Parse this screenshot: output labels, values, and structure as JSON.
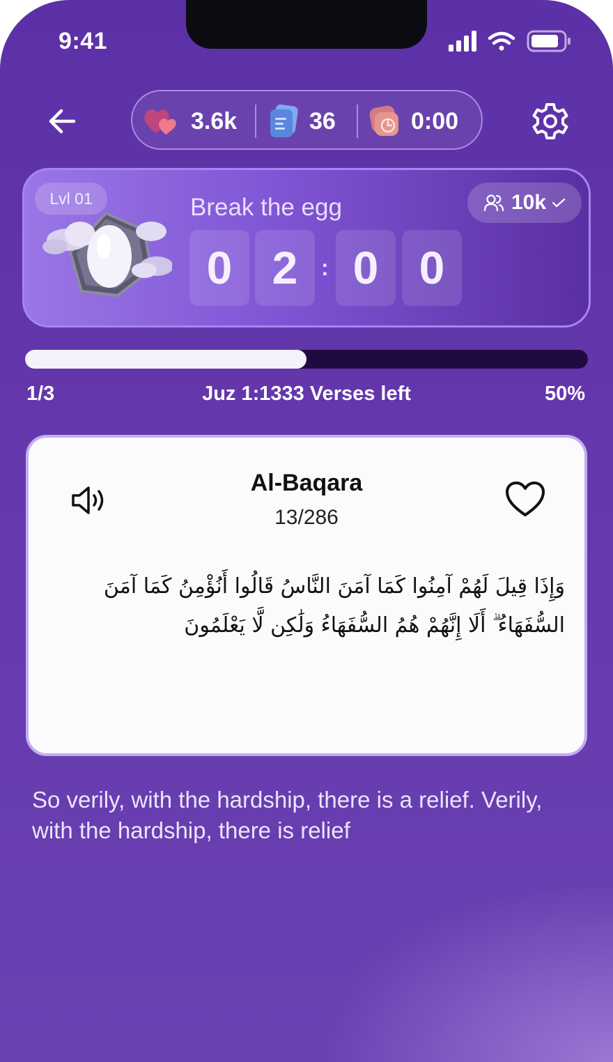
{
  "status_bar": {
    "time": "9:41"
  },
  "top_bar": {
    "stats": [
      {
        "icon": "hearts-icon",
        "value": "3.6k"
      },
      {
        "icon": "cards-icon",
        "value": "36"
      },
      {
        "icon": "timer-icon",
        "value": "0:00"
      }
    ]
  },
  "challenge": {
    "level": "Lvl 01",
    "title": "Break the egg",
    "players": "10k",
    "timer_digits": [
      "0",
      "2",
      "0",
      "0"
    ]
  },
  "progress": {
    "fraction": 0.5,
    "left_label": "1/3",
    "center_label": "Juz 1:1333 Verses left",
    "right_label": "50%"
  },
  "verse": {
    "surah": "Al-Baqara",
    "ayah": "13/286",
    "arabic_text": "وَإِذَا قِيلَ لَهُمْ آمِنُوا كَمَا آمَنَ النَّاسُ قَالُوا أَنُؤْمِنُ كَمَا آمَنَ السُّفَهَاءُ ۗ أَلَا إِنَّهُمْ هُمُ السُّفَهَاءُ وَلَٰكِن لَّا يَعْلَمُونَ",
    "translation": "So verily, with the hardship, there is a relief. Verily, with the hardship, there is relief"
  },
  "colors": {
    "accent": "#a885f0",
    "progress_track": "#1f0b42",
    "card_bg": "#fbfafd"
  }
}
